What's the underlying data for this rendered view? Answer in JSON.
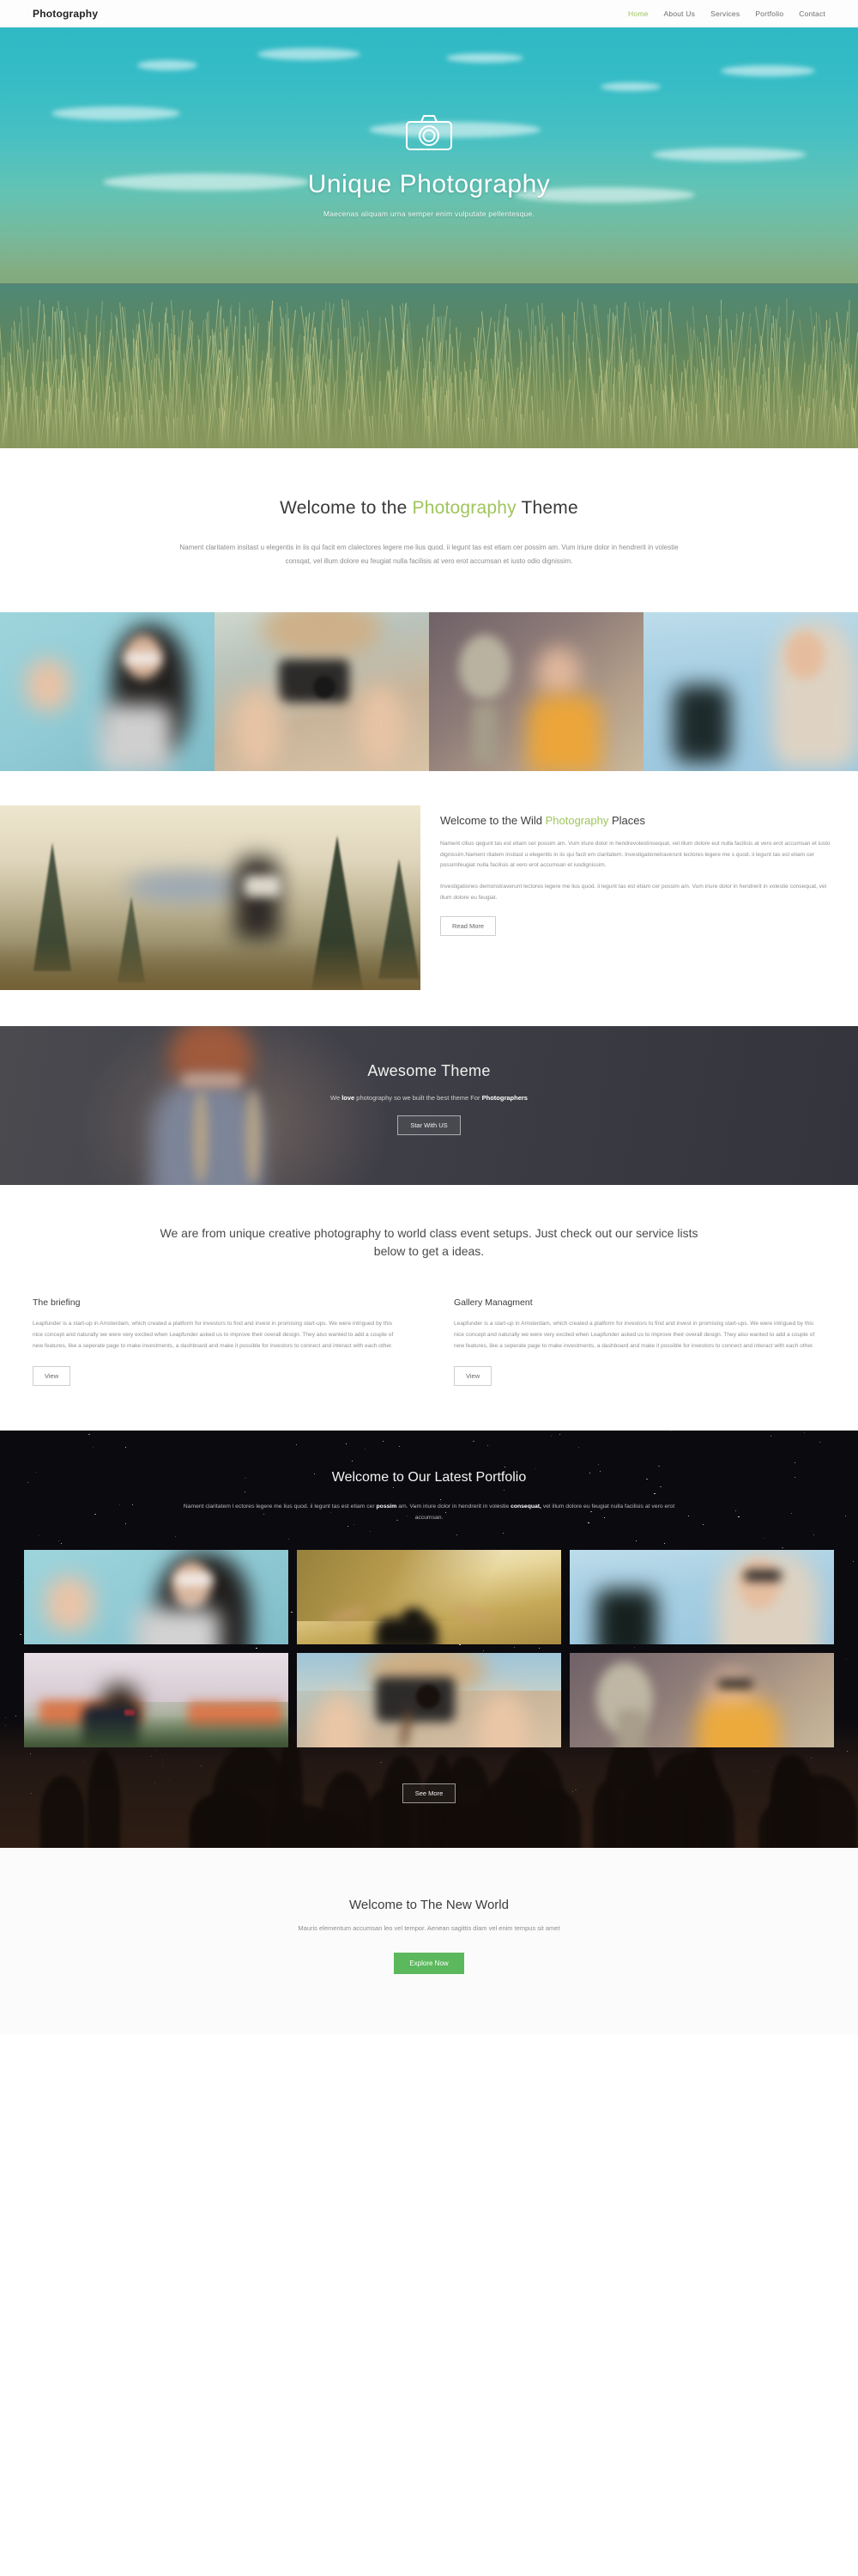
{
  "nav": {
    "brand": "Photography",
    "links": [
      {
        "label": "Home",
        "active": true
      },
      {
        "label": "About Us",
        "active": false
      },
      {
        "label": "Services",
        "active": false
      },
      {
        "label": "Portfolio",
        "active": false
      },
      {
        "label": "Contact",
        "active": false
      }
    ]
  },
  "hero": {
    "icon": "camera-icon",
    "title": "Unique Photography",
    "subtitle": "Maecenas aliquam urna semper enim vulputate pellentesque."
  },
  "welcome": {
    "title_pre": "Welcome to the ",
    "title_accent": "Photography",
    "title_post": " Theme",
    "body": "Nament claritatem insitast u elegentis in iis qui facit em clalectores legere me lius quod. ii legunt tas est etiam cer possim am. Vum iriure dolor in hendrerit in volestie consqat, vel illum dolore eu feugiat nulla facilisis at vero erot accumsan et iusto odio dignissim."
  },
  "gallery_strip": [
    {
      "name": "girl-framing-hands-blue"
    },
    {
      "name": "woman-holding-vintage-camera"
    },
    {
      "name": "woman-stone-monument"
    },
    {
      "name": "woman-sky-statue"
    }
  ],
  "wild": {
    "image": "hiker-forest-mountains",
    "title_pre": "Welcome to the Wild ",
    "title_accent": "Photography",
    "title_post": " Places",
    "paragraph1": "Nament cllius qegunt tas est etiam cer possim am. Vum iriure dolor in hendrevolestinsequat, vel illum dolore eut nulla facilisis at vero erot accumsan et iusto dignissim.Nament ritatem insitast u elegentis in iis qui facit em claritatem. Investigationetraverunt lectores legere me s quod. ii legunt tas est etiam cer possimfeugiat nulla facilisis at vero erot accumsan et iusdignissim.",
    "paragraph2": "Investigationes demonstraverunt lectores legere me lius quod. ii legunt tas est etiam cer possim am. Vum iriure dolor in hendrerit in volestie consequat, vel illum dolore eu feugiat.",
    "button": "Read More"
  },
  "awesome": {
    "image": "woman-backpack-from-behind",
    "title": "Awesome Theme",
    "sub_pre": "We ",
    "sub_bold1": "love",
    "sub_mid": " photography so we built the best theme For ",
    "sub_bold2": "Photographers",
    "button": "Star With US"
  },
  "services": {
    "lead": "We are from unique creative photography to world class event setups. Just check out our service lists below to get a ideas.",
    "columns": [
      {
        "title": "The briefing",
        "body": "Leapfunder is a start-up in Amsterdam, which created a platform for investors to find and invest in promising start-ups. We were intrigued by this nice concept and naturally we were very excited when Leapfunder asked us to improve their overall design. They also wanted to add a couple of new features, like a seperate page to make investments, a dashboard and make it possible for investors to connect and interact with each other.",
        "button": "View"
      },
      {
        "title": "Gallery Managment",
        "body": "Leapfunder is a start-up in Amsterdam, which created a platform for investors to find and invest in promising start-ups. We were intrigued by this nice concept and naturally we were very excited when Leapfunder asked us to improve their overall design. They also wanted to add a couple of new features, like a seperate page to make investments, a dashboard and make it possible for investors to connect and interact with each other.",
        "button": "View"
      }
    ]
  },
  "portfolio": {
    "title": "Welcome to Our Latest Portfolio",
    "sub_pre": "Nament claritatem l ectores legere me lius quod. ii legunt tas est etiam cer ",
    "sub_bold1": "possim",
    "sub_mid": " am. Vum iriure dolor in hendrerit in volestie ",
    "sub_bold2": "consequat,",
    "sub_post": " vel illum dolore eu feugiat nulla facilisis at vero erot accumsan.",
    "items": [
      {
        "name": "girl-framing-hands-blue"
      },
      {
        "name": "man-arms-open-wheat-field"
      },
      {
        "name": "woman-sky-statue"
      },
      {
        "name": "groom-bowtie-cityscape"
      },
      {
        "name": "woman-holding-vintage-camera"
      },
      {
        "name": "woman-stone-monument"
      }
    ],
    "button": "See More"
  },
  "footer": {
    "title": "Welcome to The New World",
    "subtitle": "Mauris elementum accumsan leo vel tempor. Aenean sagittis diam vel enim tempus sit amet",
    "button": "Explore Now"
  },
  "colors": {
    "accent_green": "#9fc55c",
    "button_green": "#5cb85c",
    "hero_sky": "#2fb9c4",
    "dark_section": "#3c3c41",
    "portfolio_bg": "#0b0a0e"
  }
}
